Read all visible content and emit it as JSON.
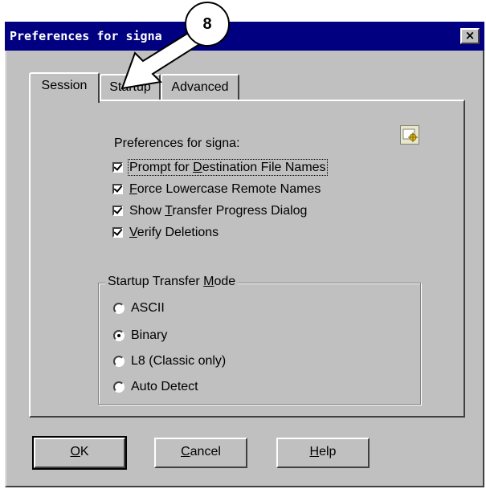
{
  "window": {
    "title": "Preferences for signa",
    "close_glyph": "×"
  },
  "tabs": [
    {
      "label": "Session",
      "active": true
    },
    {
      "label": "Startup",
      "active": false
    },
    {
      "label": "Advanced",
      "active": false
    }
  ],
  "session": {
    "heading": "Preferences for signa:",
    "icon": "preferences-icon",
    "checkboxes": [
      {
        "prefix": "",
        "mnemonic": "",
        "rest": "Prompt for ",
        "mnemonic2": "D",
        "rest2": "estination File Names",
        "checked": true
      },
      {
        "prefix": "",
        "mnemonic": "F",
        "rest": "orce Lowercase Remote Names",
        "checked": true
      },
      {
        "prefix": "Show ",
        "mnemonic": "T",
        "rest": "ransfer Progress Dialog",
        "checked": true
      },
      {
        "prefix": "",
        "mnemonic": "V",
        "rest": "erify Deletions",
        "checked": true
      }
    ],
    "transfer_mode": {
      "label_before": "Startup Transfer ",
      "label_mnemonic": "M",
      "label_after": "ode",
      "options": [
        "ASCII",
        "Binary",
        "L8  (Classic only)",
        "Auto Detect"
      ],
      "selected": "Binary"
    }
  },
  "buttons": {
    "ok_mnemonic": "O",
    "ok_rest": "K",
    "cancel_mnemonic": "C",
    "cancel_rest": "ancel",
    "help_mnemonic": "H",
    "help_rest": "elp"
  },
  "annotation": {
    "number": "8"
  }
}
